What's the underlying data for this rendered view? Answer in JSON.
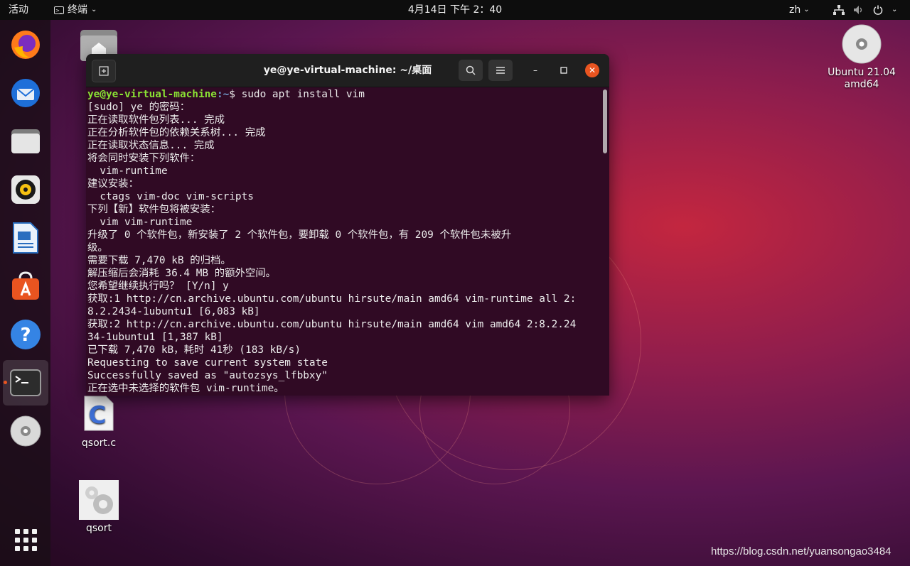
{
  "topbar": {
    "activities": "活动",
    "app_menu": "终端",
    "clock": "4月14日  下午 2：40",
    "lang": "zh",
    "icons": [
      "network-icon",
      "volume-icon",
      "power-icon"
    ]
  },
  "dock": {
    "items": [
      "firefox",
      "thunderbird",
      "files",
      "rhythmbox",
      "libreoffice-writer",
      "ubuntu-software",
      "help",
      "terminal",
      "dvd"
    ],
    "active": "terminal",
    "show_apps": "apps-grid"
  },
  "desktop": {
    "icons": [
      {
        "label": "Ubuntu 21.04\namd64",
        "type": "dvd"
      },
      {
        "label": "qsort.c",
        "type": "c-source"
      },
      {
        "label": "qsort",
        "type": "executable"
      }
    ]
  },
  "terminal": {
    "title": "ye@ye-virtual-machine: ~/桌面",
    "prompt_user": "ye@ye-virtual-machine",
    "prompt_path": ":~",
    "prompt_cmd": "$ sudo apt install vim",
    "lines": [
      "[sudo] ye 的密码：",
      "正在读取软件包列表... 完成",
      "正在分析软件包的依赖关系树... 完成",
      "正在读取状态信息... 完成",
      "将会同时安装下列软件：",
      "  vim-runtime",
      "建议安装：",
      "  ctags vim-doc vim-scripts",
      "下列【新】软件包将被安装：",
      "  vim vim-runtime",
      "升级了 0 个软件包，新安装了 2 个软件包，要卸载 0 个软件包，有 209 个软件包未被升",
      "级。",
      "需要下载 7,470 kB 的归档。",
      "解压缩后会消耗 36.4 MB 的额外空间。",
      "您希望继续执行吗？ [Y/n] y",
      "获取:1 http://cn.archive.ubuntu.com/ubuntu hirsute/main amd64 vim-runtime all 2:",
      "8.2.2434-1ubuntu1 [6,083 kB]",
      "获取:2 http://cn.archive.ubuntu.com/ubuntu hirsute/main amd64 vim amd64 2:8.2.24",
      "34-1ubuntu1 [1,387 kB]",
      "已下载 7,470 kB，耗时 41秒 (183 kB/s)",
      "Requesting to save current system state",
      "Successfully saved as \"autozsys_lfbbxy\"",
      "正在选中未选择的软件包 vim-runtime。"
    ]
  },
  "watermark": "https://blog.csdn.net/yuansongao3484"
}
